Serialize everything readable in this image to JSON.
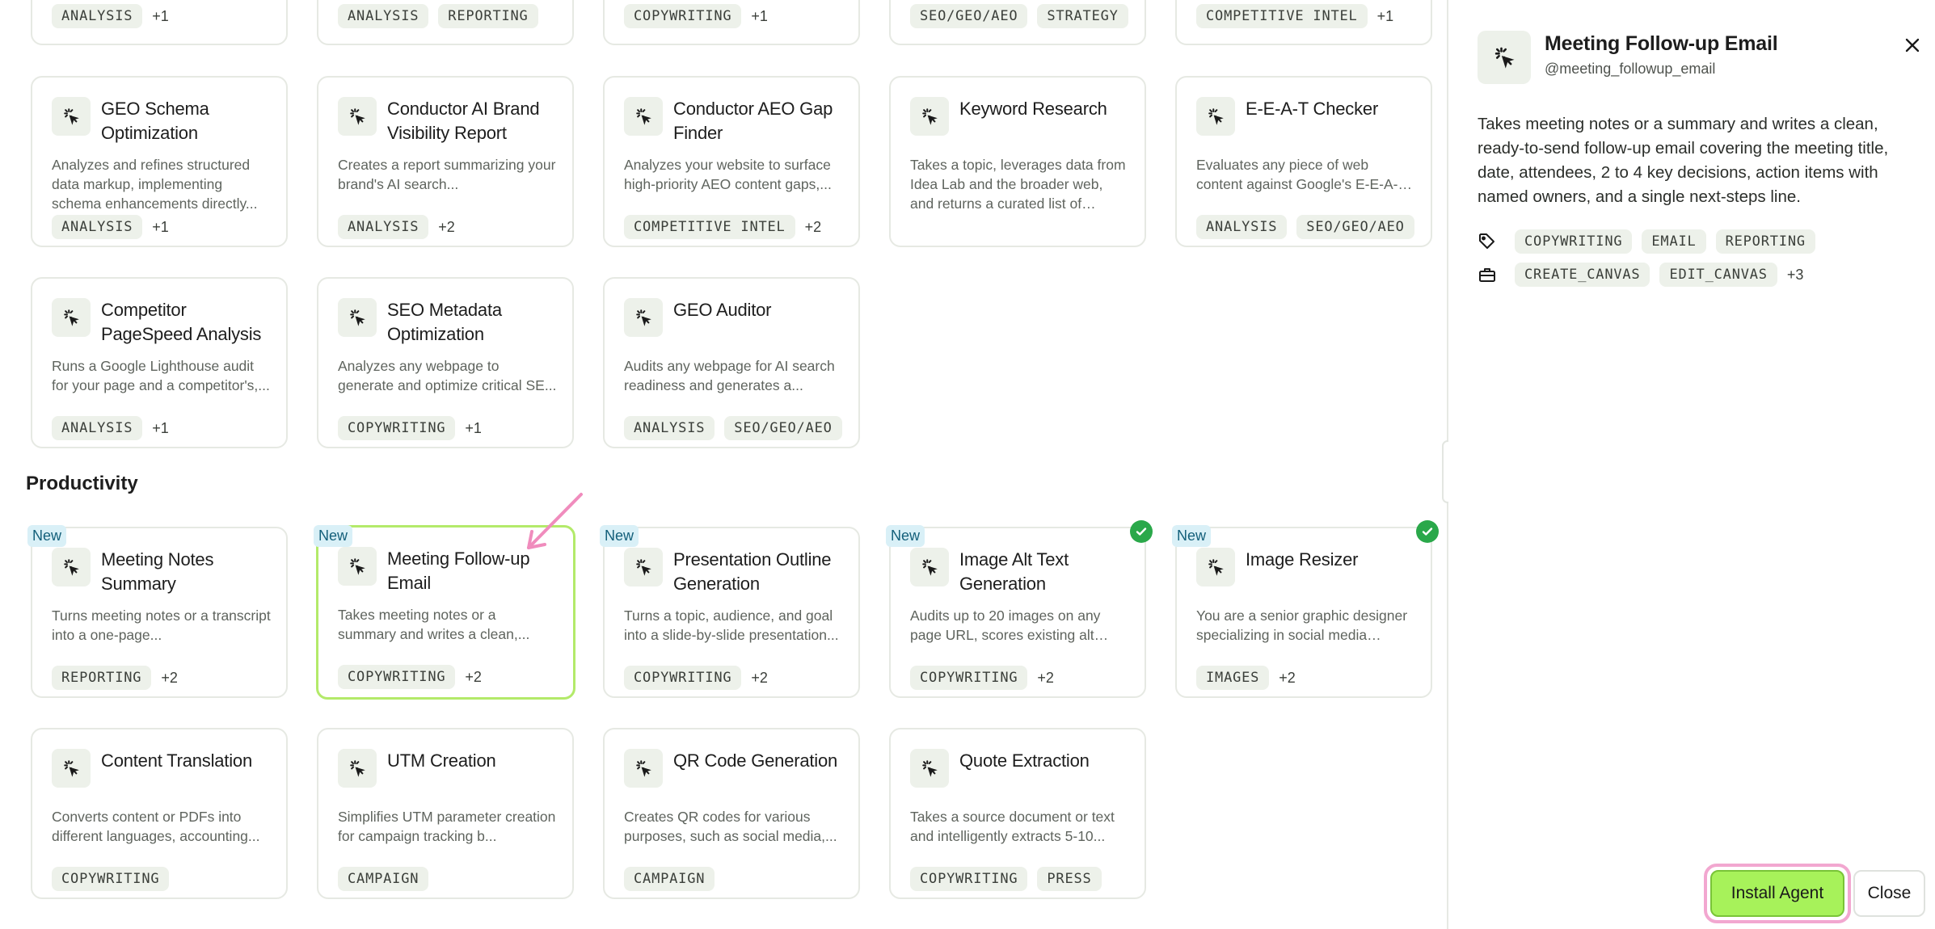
{
  "top_cut_cards": [
    {
      "tags": [
        "ANALYSIS"
      ],
      "more": "+1"
    },
    {
      "tags": [
        "ANALYSIS",
        "REPORTING"
      ],
      "more": ""
    },
    {
      "tags": [
        "COPYWRITING"
      ],
      "more": "+1"
    },
    {
      "tags": [
        "SEO/GEO/AEO",
        "STRATEGY"
      ],
      "more": ""
    },
    {
      "tags": [
        "COMPETITIVE INTEL"
      ],
      "more": "+1"
    }
  ],
  "cards_row1": [
    {
      "title": "GEO Schema Optimization",
      "desc": "Analyzes and refines structured data markup, implementing schema enhancements directly...",
      "tags": [
        "ANALYSIS"
      ],
      "more": "+1"
    },
    {
      "title": "Conductor AI Brand Visibility Report",
      "desc": "Creates a report summarizing your brand's AI search...",
      "tags": [
        "ANALYSIS"
      ],
      "more": "+2"
    },
    {
      "title": "Conductor AEO Gap Finder",
      "desc": "Analyzes your website to surface high-priority AEO content gaps,...",
      "tags": [
        "COMPETITIVE INTEL"
      ],
      "more": "+2"
    },
    {
      "title": "Keyword Research",
      "desc": "Takes a topic, leverages data from Idea Lab and the broader web, and returns a curated list of keywords...",
      "tags": [],
      "more": ""
    },
    {
      "title": "E-E-A-T Checker",
      "desc": "Evaluates any piece of web content against Google's E-E-A-T ...",
      "tags": [
        "ANALYSIS",
        "SEO/GEO/AEO"
      ],
      "more": ""
    }
  ],
  "cards_row2": [
    {
      "title": "Competitor PageSpeed Analysis",
      "desc": "Runs a Google Lighthouse audit for your page and a competitor's,...",
      "tags": [
        "ANALYSIS"
      ],
      "more": "+1"
    },
    {
      "title": "SEO Metadata Optimization",
      "desc": "Analyzes any webpage to generate and optimize critical SE...",
      "tags": [
        "COPYWRITING"
      ],
      "more": "+1"
    },
    {
      "title": "GEO Auditor",
      "desc": "Audits any webpage for AI search readiness and generates a...",
      "tags": [
        "ANALYSIS",
        "SEO/GEO/AEO"
      ],
      "more": ""
    }
  ],
  "section_heading": "Productivity",
  "new_badge": "New",
  "cards_row3": [
    {
      "title": "Meeting Notes Summary",
      "desc": "Turns meeting notes or a transcript into a one-page...",
      "tags": [
        "REPORTING"
      ],
      "more": "+2"
    },
    {
      "title": "Meeting Follow-up Email",
      "desc": "Takes meeting notes or a summary and writes a clean,...",
      "tags": [
        "COPYWRITING"
      ],
      "more": "+2"
    },
    {
      "title": "Presentation Outline Generation",
      "desc": "Turns a topic, audience, and goal into a slide-by-slide presentation...",
      "tags": [
        "COPYWRITING"
      ],
      "more": "+2"
    },
    {
      "title": "Image Alt Text Generation",
      "desc": "Audits up to 20 images on any page URL, scores existing alt text...",
      "tags": [
        "COPYWRITING"
      ],
      "more": "+2"
    },
    {
      "title": "Image Resizer",
      "desc": "You are a senior graphic designer specializing in social media asset...",
      "tags": [
        "IMAGES"
      ],
      "more": "+2"
    }
  ],
  "cards_row4": [
    {
      "title": "Content Translation",
      "desc": "Converts content or PDFs into different languages, accounting...",
      "tags": [
        "COPYWRITING"
      ],
      "more": ""
    },
    {
      "title": "UTM Creation",
      "desc": "Simplifies UTM parameter creation for campaign tracking b...",
      "tags": [
        "CAMPAIGN"
      ],
      "more": ""
    },
    {
      "title": "QR Code Generation",
      "desc": "Creates QR codes for various purposes, such as social media,...",
      "tags": [
        "CAMPAIGN"
      ],
      "more": ""
    },
    {
      "title": "Quote Extraction",
      "desc": "Takes a source document or text and intelligently extracts 5-10...",
      "tags": [
        "COPYWRITING",
        "PRESS"
      ],
      "more": ""
    }
  ],
  "panel": {
    "title": "Meeting Follow-up Email",
    "handle": "@meeting_followup_email",
    "description": "Takes meeting notes or a summary and writes a clean, ready-to-send follow-up email covering the meeting title, date, attendees, 2 to 4 key decisions, action items with named owners, and a single next-steps line.",
    "category_tags": [
      "COPYWRITING",
      "EMAIL",
      "REPORTING"
    ],
    "tool_tags": [
      "CREATE_CANVAS",
      "EDIT_CANVAS"
    ],
    "tool_more": "+3",
    "install_label": "Install Agent",
    "close_label": "Close"
  },
  "colors": {
    "accent": "#a7f25a",
    "selected_border": "#b3ea6a",
    "new_badge_bg": "#d9f0f7",
    "check_green": "#2aa84a",
    "highlight_pink": "#f2a7d0"
  },
  "icons": {
    "agent": "cursor-click-icon",
    "tag": "tag-icon",
    "tools": "toolbox-icon",
    "close": "close-icon",
    "check": "check-icon"
  }
}
